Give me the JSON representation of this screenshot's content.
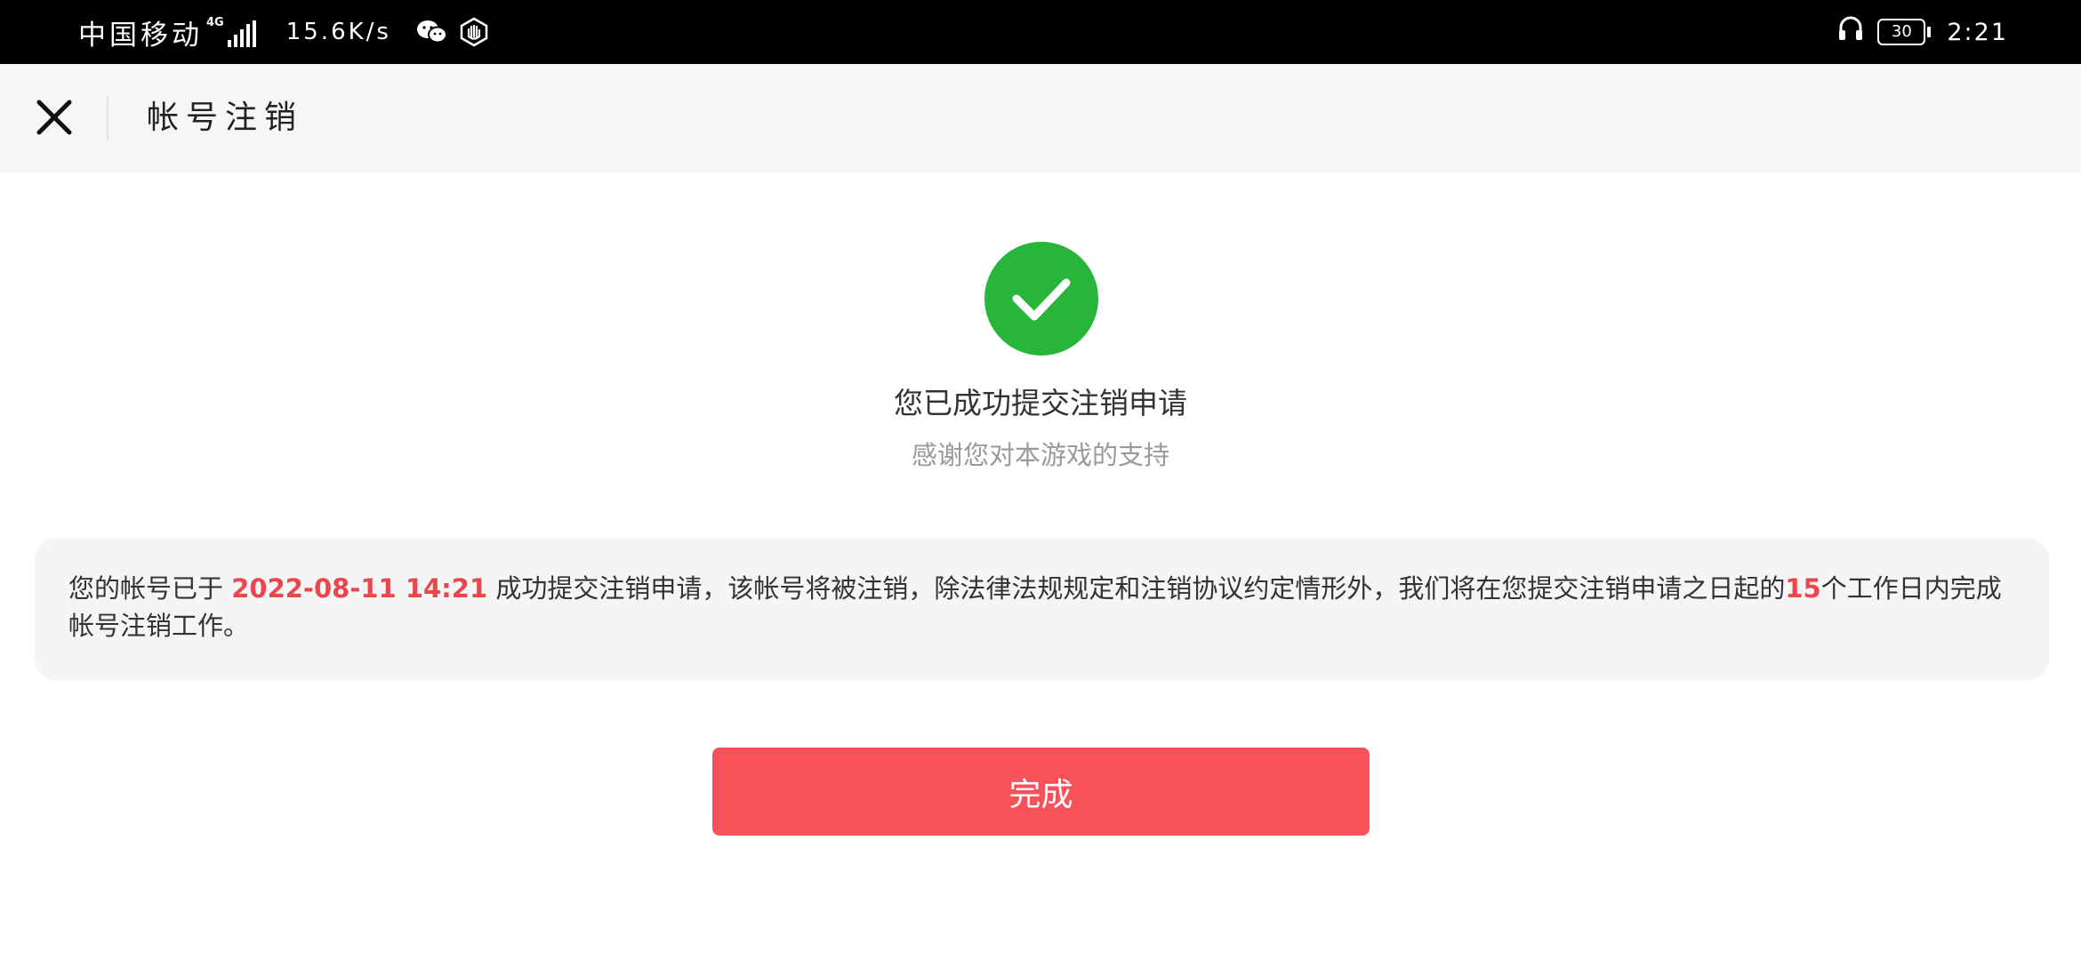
{
  "status_bar": {
    "carrier": "中国移动",
    "network": "4G",
    "speed": "15.6K/s",
    "battery": "30",
    "time": "2:21"
  },
  "header": {
    "title": "帐号注销"
  },
  "success": {
    "title": "您已成功提交注销申请",
    "subtitle": "感谢您对本游戏的支持"
  },
  "notice": {
    "prefix": "您的帐号已于 ",
    "datetime": "2022-08-11 14:21",
    "middle": " 成功提交注销申请，该帐号将被注销，除法律法规规定和注销协议约定情形外，我们将在您提交注销申请之日起的",
    "days": "15",
    "suffix": "个工作日内完成帐号注销工作。"
  },
  "actions": {
    "done_label": "完成"
  },
  "colors": {
    "success_green": "#27b53a",
    "accent_red": "#f7525a",
    "highlight_red": "#e8474e"
  }
}
